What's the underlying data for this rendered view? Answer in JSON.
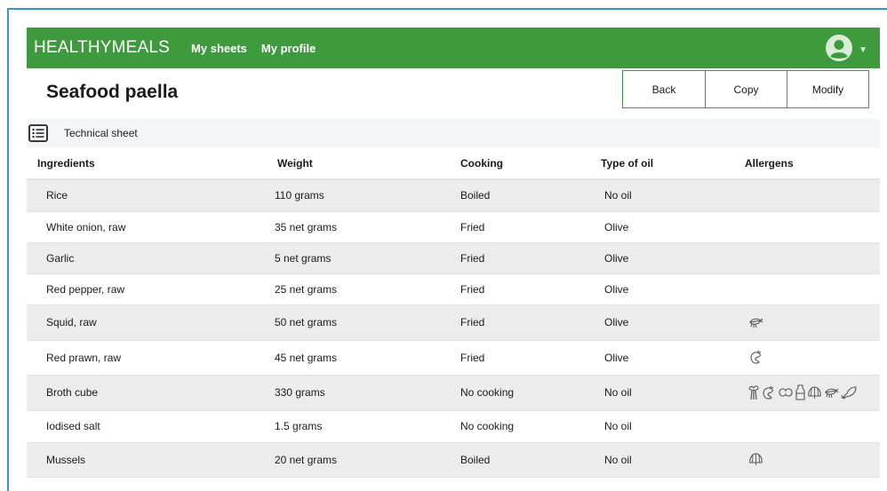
{
  "navbar": {
    "brand": "HEALTHYMEALS",
    "links": [
      "My sheets",
      "My profile"
    ],
    "user_icon": "user-circle-icon"
  },
  "page": {
    "title": "Seafood paella"
  },
  "actions": {
    "back": "Back",
    "copy": "Copy",
    "modify": "Modify"
  },
  "tab": {
    "icon": "list-icon",
    "label": "Technical sheet"
  },
  "table": {
    "headers": [
      "Ingredients",
      "Weight",
      "Cooking",
      "Type of oil",
      "Allergens"
    ],
    "rows": [
      {
        "ingredient": "Rice",
        "weight": "110 grams",
        "cooking": "Boiled",
        "oil": "No oil",
        "allergens": []
      },
      {
        "ingredient": "White onion, raw",
        "weight": "35 net grams",
        "cooking": "Fried",
        "oil": "Olive",
        "allergens": []
      },
      {
        "ingredient": "Garlic",
        "weight": "5 net grams",
        "cooking": "Fried",
        "oil": "Olive",
        "allergens": []
      },
      {
        "ingredient": "Red pepper, raw",
        "weight": "25 net grams",
        "cooking": "Fried",
        "oil": "Olive",
        "allergens": []
      },
      {
        "ingredient": "Squid, raw",
        "weight": "50 net grams",
        "cooking": "Fried",
        "oil": "Olive",
        "allergens": [
          "mollusc-icon"
        ]
      },
      {
        "ingredient": "Red prawn, raw",
        "weight": "45 net grams",
        "cooking": "Fried",
        "oil": "Olive",
        "allergens": [
          "crustacean-icon"
        ]
      },
      {
        "ingredient": "Broth cube",
        "weight": "330 grams",
        "cooking": "No cooking",
        "oil": "No oil",
        "allergens": [
          "celery-icon",
          "crustacean-icon",
          "peanut-icon",
          "milk-icon",
          "shellfish-icon",
          "mollusc-icon",
          "fish-icon"
        ]
      },
      {
        "ingredient": "Iodised salt",
        "weight": "1.5 grams",
        "cooking": "No cooking",
        "oil": "No oil",
        "allergens": []
      },
      {
        "ingredient": "Mussels",
        "weight": "20 net grams",
        "cooking": "Boiled",
        "oil": "No oil",
        "allergens": [
          "shellfish-icon"
        ]
      }
    ]
  },
  "colors": {
    "brand_green": "#3d9b3e",
    "frame_blue": "#3a93c9",
    "row_stripe": "#ececec"
  }
}
